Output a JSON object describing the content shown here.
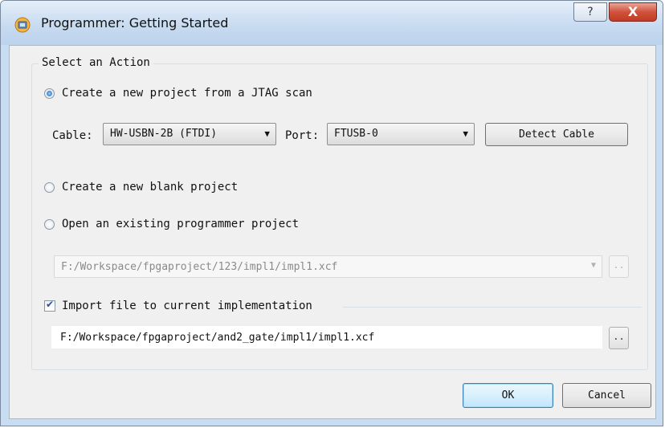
{
  "window": {
    "title": "Programmer: Getting Started",
    "help_glyph": "?",
    "close_glyph": "X",
    "icon": "programmer-app-icon"
  },
  "group": {
    "legend": "Select an Action"
  },
  "options": {
    "jtag_scan": {
      "label": "Create a new project from a JTAG scan",
      "selected": true
    },
    "blank": {
      "label": "Create a new blank project",
      "selected": false
    },
    "existing": {
      "label": "Open an existing programmer project",
      "selected": false
    }
  },
  "cable": {
    "label": "Cable:",
    "value": "HW-USBN-2B (FTDI)",
    "port_label": "Port:",
    "port_value": "FTUSB-0",
    "detect_button": "Detect Cable"
  },
  "existing_project": {
    "path": "F:/Workspace/fpgaproject/123/impl1/impl1.xcf",
    "browse": ".."
  },
  "import": {
    "label": "Import file to current implementation",
    "checked": true,
    "path": "F:/Workspace/fpgaproject/and2_gate/impl1/impl1.xcf",
    "browse": ".."
  },
  "footer": {
    "ok": "OK",
    "cancel": "Cancel"
  },
  "colors": {
    "title_bar": "#c6daf0",
    "close_button": "#c23b25",
    "client_bg": "#f0f0f0",
    "default_button_border": "#3c7fb1"
  }
}
